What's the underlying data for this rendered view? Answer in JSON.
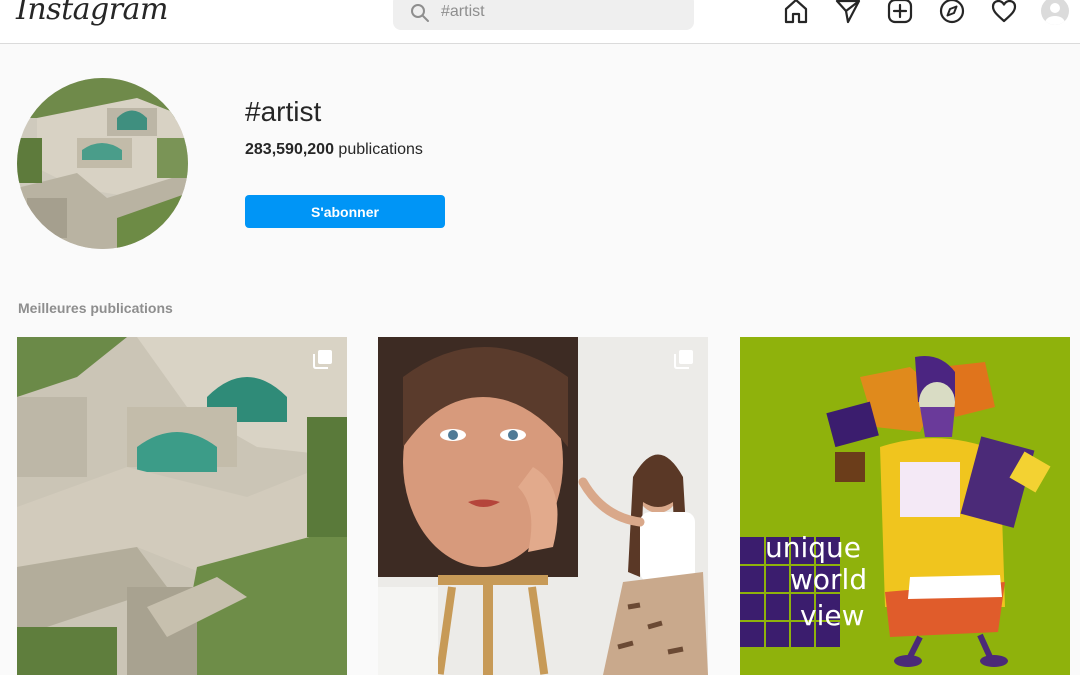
{
  "app": {
    "name": "Instagram"
  },
  "search": {
    "placeholder": "#artist"
  },
  "nav": {
    "icons": [
      "home-icon",
      "direct-icon",
      "new-post-icon",
      "explore-icon",
      "activity-icon",
      "profile-avatar"
    ]
  },
  "hashtag": {
    "title": "#artist",
    "count": "283,590,200",
    "count_label": " publications",
    "follow_label": "S'abonner"
  },
  "section": {
    "title": "Meilleures publications"
  },
  "posts": [
    {
      "kind": "architecture-garden",
      "multiple": true
    },
    {
      "kind": "painter-with-portrait",
      "multiple": true
    },
    {
      "kind": "illustration",
      "multiple": false,
      "text_lines": [
        "unique",
        "world",
        "view"
      ]
    }
  ],
  "colors": {
    "accent": "#0095f6",
    "border": "#dbdbdb",
    "background": "#fafafa"
  }
}
